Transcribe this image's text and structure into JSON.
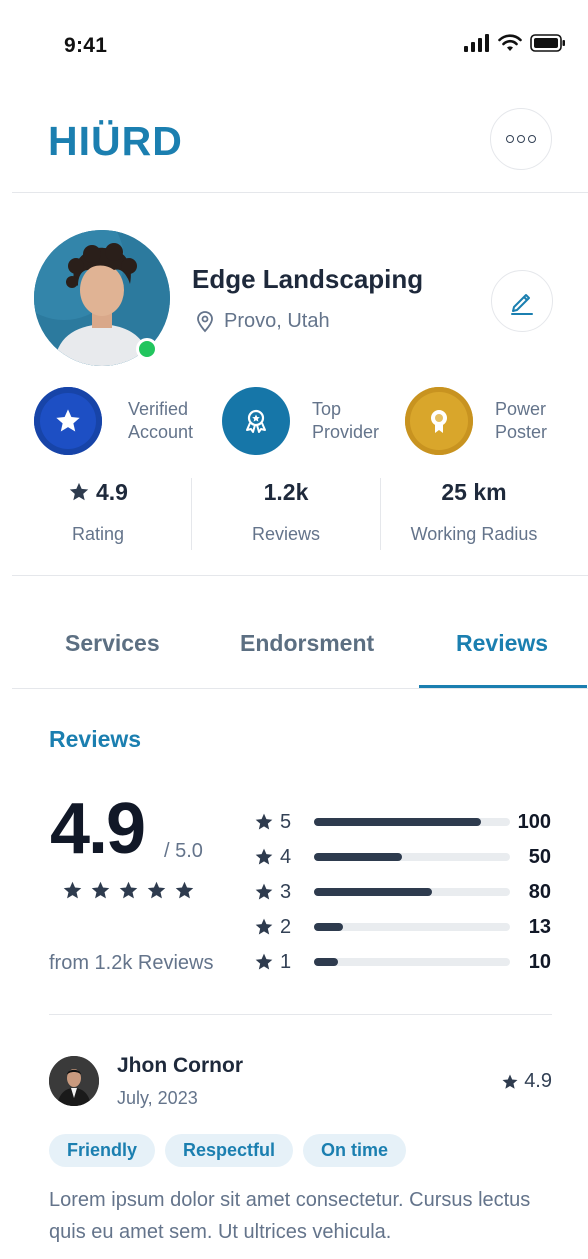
{
  "status_bar": {
    "time": "9:41"
  },
  "header": {
    "logo": "HIÜRD"
  },
  "profile": {
    "name": "Edge Landscaping",
    "location": "Provo, Utah",
    "online": true
  },
  "badges": [
    {
      "line1": "Verified",
      "line2": "Account",
      "color": "#1d4fc4",
      "icon": "star-icon"
    },
    {
      "line1": "Top",
      "line2": "Provider",
      "color": "#1676a8",
      "icon": "award-icon"
    },
    {
      "line1": "Power",
      "line2": "Poster",
      "color": "#d9a62b",
      "icon": "medal-icon"
    }
  ],
  "stats": [
    {
      "value": "4.9",
      "label": "Rating"
    },
    {
      "value": "1.2k",
      "label": "Reviews"
    },
    {
      "value": "25 km",
      "label": "Working Radius"
    }
  ],
  "tabs": [
    {
      "label": "Services",
      "active": false
    },
    {
      "label": "Endorsment",
      "active": false
    },
    {
      "label": "Reviews",
      "active": true
    }
  ],
  "reviews_section": {
    "title": "Reviews",
    "average": "4.9",
    "out_of": "/ 5.0",
    "from_count": "from 1.2k Reviews",
    "distribution": [
      {
        "stars": "5",
        "count": "100",
        "fraction": 0.85
      },
      {
        "stars": "4",
        "count": "50",
        "fraction": 0.45
      },
      {
        "stars": "3",
        "count": "80",
        "fraction": 0.6
      },
      {
        "stars": "2",
        "count": "13",
        "fraction": 0.15
      },
      {
        "stars": "1",
        "count": "10",
        "fraction": 0.12
      }
    ]
  },
  "review": {
    "author": "Jhon Cornor",
    "date": "July, 2023",
    "rating": "4.9",
    "tags": [
      "Friendly",
      "Respectful",
      "On time"
    ],
    "text": "Lorem ipsum dolor sit amet consectetur. Cursus lectus quis eu amet sem. Ut ultrices vehicula."
  },
  "colors": {
    "accent": "#1b7fb0",
    "online": "#22c55e",
    "bar": "#2e3b4e"
  }
}
